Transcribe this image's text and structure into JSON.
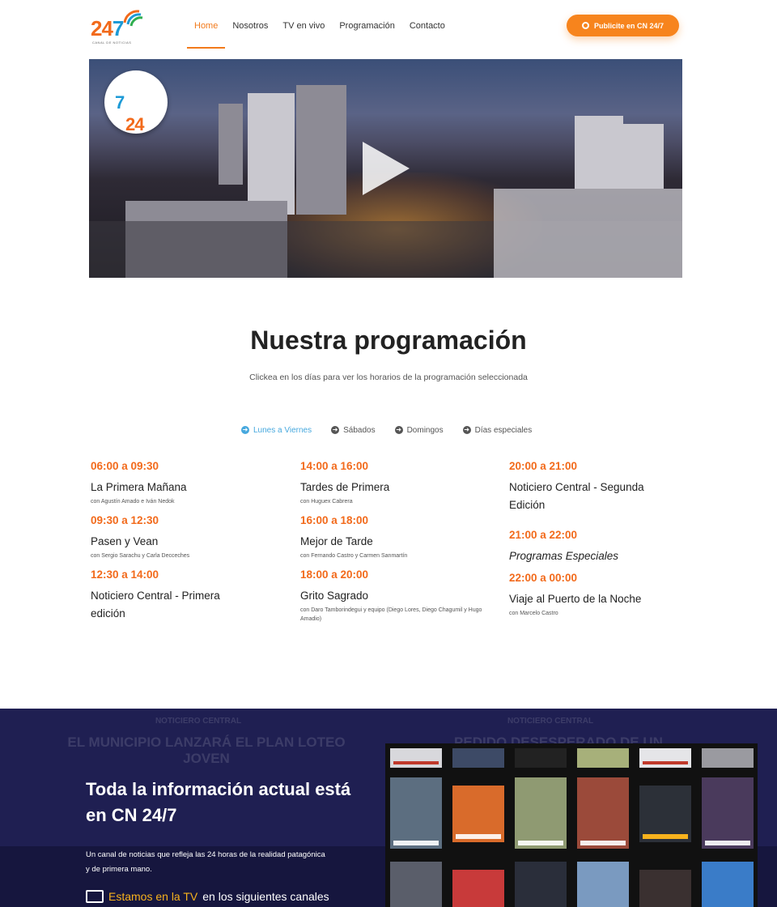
{
  "nav": {
    "logo_number": "24",
    "logo_seven": "7",
    "logo_tag": "CANAL DE NOTICIAS",
    "items": [
      "Home",
      "Nosotros",
      "TV en vivo",
      "Programación",
      "Contacto"
    ],
    "active_item": "Home",
    "cta_label": "Publicite en CN 24/7"
  },
  "hero": {
    "logo_number": "24",
    "logo_seven": "7"
  },
  "programming": {
    "title": "Nuestra programación",
    "subtitle": "Clickea en los días para ver los horarios de la programación seleccionada",
    "tabs": [
      "Lunes a Viernes",
      "Sábados",
      "Domingos",
      "Días especiales"
    ],
    "active_tab": "Lunes a Viernes",
    "columns": [
      [
        {
          "time": "06:00 a 09:30",
          "name": "La Primera Mañana",
          "host": "con Agustín Amado e Iván Nedok"
        },
        {
          "time": "09:30 a 12:30",
          "name": "Pasen y Vean",
          "host": "con Sergio Sarachu y Carla Decceches"
        },
        {
          "time": "12:30 a 14:00",
          "name": "Noticiero Central - Primera edición",
          "host": ""
        }
      ],
      [
        {
          "time": "14:00 a 16:00",
          "name": "Tardes de Primera",
          "host": "con Huguex Cabrera"
        },
        {
          "time": "16:00 a 18:00",
          "name": "Mejor de Tarde",
          "host": "con Fernando Castro y Carmen Sanmartín"
        },
        {
          "time": "18:00 a 20:00",
          "name": "Grito Sagrado",
          "host": "con Daro Tamborindegui y equipo (Diego Lores, Diego Chagumil y Hugo Amadio)"
        }
      ],
      [
        {
          "time": "20:00 a 21:00",
          "name": "Noticiero Central - Segunda Edición",
          "host": ""
        },
        {
          "time": "21:00 a 22:00",
          "name": "Programas Especiales",
          "host": "",
          "italic": true
        },
        {
          "time": "22:00 a 00:00",
          "name": "Viaje al Puerto de la Noche",
          "host": "con Marcelo Castro"
        }
      ]
    ]
  },
  "bottom": {
    "bg_ghost_1": "NOTICIERO CENTRAL",
    "bg_ghost_2": "EL MUNICIPIO LANZARÁ EL PLAN LOTEO JOVEN",
    "bg_ghost_3": "NOTICIERO CENTRAL",
    "bg_ghost_4": "PEDIDO DESESPERADO DE UN",
    "heading": "Toda la información actual está en CN 24/7",
    "description": "Un canal de noticias que refleja las 24 horas de la realidad patagónica y de primera mano.",
    "tv_highlight": "Estamos en la TV",
    "tv_rest": "en los siguientes canales"
  },
  "colors": {
    "accent_orange": "#f26a1b",
    "accent_blue": "#46a8de",
    "dark_band": "#1f1f52"
  }
}
